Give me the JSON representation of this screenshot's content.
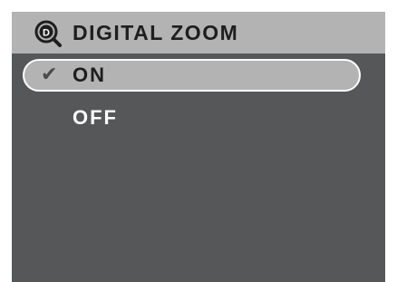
{
  "title": {
    "icon": "digital-zoom-icon",
    "icon_letter": "D",
    "text": "DIGITAL ZOOM"
  },
  "options": [
    {
      "label": "ON",
      "selected": true,
      "check_mark": "✔"
    },
    {
      "label": "OFF",
      "selected": false
    }
  ],
  "colors": {
    "screen_bg": "#555759",
    "highlight_bg": "#b3b3b3",
    "highlight_border": "#ffffff",
    "dark_text": "#1e1e1e",
    "light_text": "#ffffff"
  }
}
